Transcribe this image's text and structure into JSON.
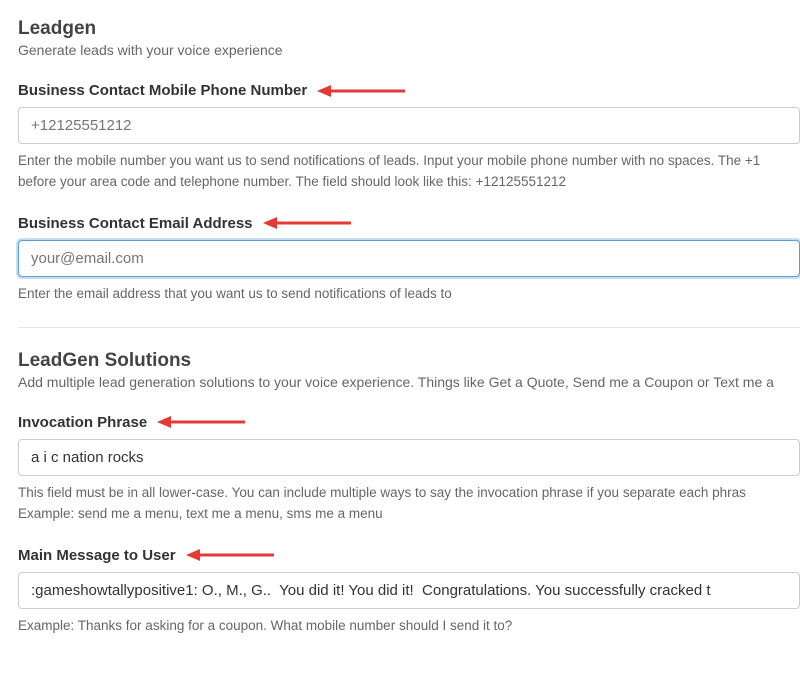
{
  "leadgen": {
    "title": "Leadgen",
    "subtitle": "Generate leads with your voice experience",
    "phone": {
      "label": "Business Contact Mobile Phone Number",
      "placeholder": "+12125551212",
      "help": "Enter the mobile number you want us to send notifications of leads. Input your mobile phone number with no spaces. The +1 before your area code and telephone number. The field should look like this: +12125551212"
    },
    "email": {
      "label": "Business Contact Email Address",
      "placeholder": "your@email.com",
      "help": "Enter the email address that you want us to send notifications of leads to"
    }
  },
  "solutions": {
    "title": "LeadGen Solutions",
    "subtitle": "Add multiple lead generation solutions to your voice experience. Things like Get a Quote, Send me a Coupon or Text me a",
    "invocation": {
      "label": "Invocation Phrase",
      "value": "a i c nation rocks",
      "help": "This field must be in all lower-case. You can include multiple ways to say the invocation phrase if you separate each phras Example: send me a menu, text me a menu, sms me a menu"
    },
    "main_message": {
      "label": "Main Message to User",
      "value": ":gameshowtallypositive1: O., M., G..  You did it! You did it!  Congratulations. You successfully cracked t",
      "help": "Example: Thanks for asking for a coupon. What mobile number should I send it to?"
    }
  }
}
